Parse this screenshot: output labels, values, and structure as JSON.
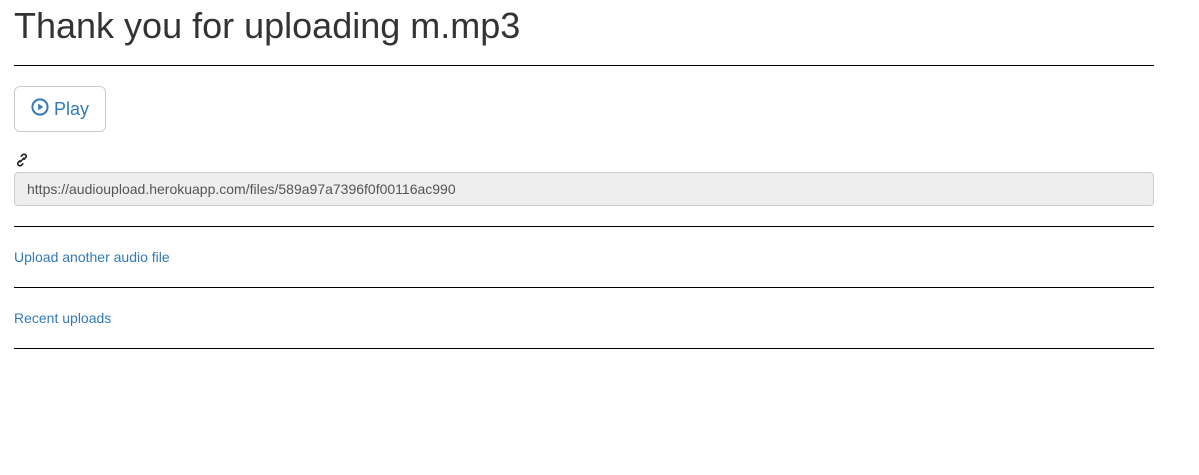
{
  "header": {
    "title": "Thank you for uploading m.mp3"
  },
  "player": {
    "play_label": "Play",
    "play_icon": "play-circle-icon"
  },
  "share": {
    "link_icon": "link-icon",
    "url_value": "https://audioupload.herokuapp.com/files/589a97a7396f0f00116ac990"
  },
  "links": {
    "upload_another": "Upload another audio file",
    "recent_uploads": "Recent uploads"
  },
  "colors": {
    "link": "#337ab7",
    "text": "#333333",
    "input_bg": "#eeeeee",
    "border": "#cccccc",
    "rule": "#000000"
  }
}
